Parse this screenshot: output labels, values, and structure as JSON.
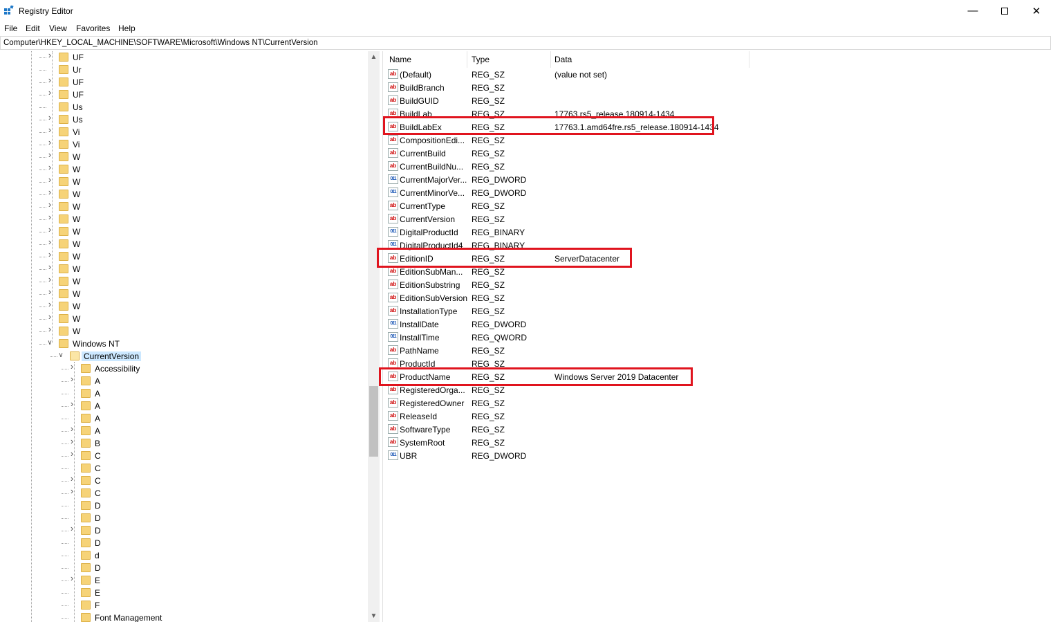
{
  "window": {
    "title": "Registry Editor"
  },
  "menu": [
    "File",
    "Edit",
    "View",
    "Favorites",
    "Help"
  ],
  "address": "Computer\\HKEY_LOCAL_MACHINE\\SOFTWARE\\Microsoft\\Windows NT\\CurrentVersion",
  "tree": {
    "siblings": [
      "UF",
      "Ur",
      "UF",
      "UF",
      "Us",
      "Us",
      "Vi",
      "Vi",
      "W",
      "W",
      "W",
      "W",
      "W",
      "W",
      "W",
      "W",
      "W",
      "W",
      "W",
      "W",
      "W",
      "W",
      "W"
    ],
    "parent": "Windows NT",
    "selected": "CurrentVersion",
    "children": [
      "Accessibility",
      "A",
      "A",
      "A",
      "A",
      "A",
      "B",
      "C",
      "C",
      "C",
      "C",
      "D",
      "D",
      "D",
      "D",
      "d",
      "D",
      "E",
      "E",
      "F",
      "Font Management"
    ]
  },
  "columns": {
    "name": "Name",
    "type": "Type",
    "data": "Data"
  },
  "values": [
    {
      "name": "(Default)",
      "type": "REG_SZ",
      "data": "(value not set)",
      "icon": "ab"
    },
    {
      "name": "BuildBranch",
      "type": "REG_SZ",
      "data": "",
      "icon": "ab"
    },
    {
      "name": "BuildGUID",
      "type": "REG_SZ",
      "data": "",
      "icon": "ab"
    },
    {
      "name": "BuildLab",
      "type": "REG_SZ",
      "data": "17763.rs5_release.180914-1434",
      "icon": "ab"
    },
    {
      "name": "BuildLabEx",
      "type": "REG_SZ",
      "data": "17763.1.amd64fre.rs5_release.180914-1434",
      "icon": "ab"
    },
    {
      "name": "CompositionEdi...",
      "type": "REG_SZ",
      "data": "",
      "icon": "ab"
    },
    {
      "name": "CurrentBuild",
      "type": "REG_SZ",
      "data": "",
      "icon": "ab"
    },
    {
      "name": "CurrentBuildNu...",
      "type": "REG_SZ",
      "data": "",
      "icon": "ab"
    },
    {
      "name": "CurrentMajorVer...",
      "type": "REG_DWORD",
      "data": "",
      "icon": "bin"
    },
    {
      "name": "CurrentMinorVe...",
      "type": "REG_DWORD",
      "data": "",
      "icon": "bin"
    },
    {
      "name": "CurrentType",
      "type": "REG_SZ",
      "data": "",
      "icon": "ab"
    },
    {
      "name": "CurrentVersion",
      "type": "REG_SZ",
      "data": "",
      "icon": "ab"
    },
    {
      "name": "DigitalProductId",
      "type": "REG_BINARY",
      "data": "",
      "icon": "bin"
    },
    {
      "name": "DigitalProductId4",
      "type": "REG_BINARY",
      "data": "",
      "icon": "bin"
    },
    {
      "name": "EditionID",
      "type": "REG_SZ",
      "data": "ServerDatacenter",
      "icon": "ab"
    },
    {
      "name": "EditionSubMan...",
      "type": "REG_SZ",
      "data": "",
      "icon": "ab"
    },
    {
      "name": "EditionSubstring",
      "type": "REG_SZ",
      "data": "",
      "icon": "ab"
    },
    {
      "name": "EditionSubVersion",
      "type": "REG_SZ",
      "data": "",
      "icon": "ab"
    },
    {
      "name": "InstallationType",
      "type": "REG_SZ",
      "data": "",
      "icon": "ab"
    },
    {
      "name": "InstallDate",
      "type": "REG_DWORD",
      "data": "",
      "icon": "bin"
    },
    {
      "name": "InstallTime",
      "type": "REG_QWORD",
      "data": "",
      "icon": "bin"
    },
    {
      "name": "PathName",
      "type": "REG_SZ",
      "data": "",
      "icon": "ab"
    },
    {
      "name": "ProductId",
      "type": "REG_SZ",
      "data": "",
      "icon": "ab"
    },
    {
      "name": "ProductName",
      "type": "REG_SZ",
      "data": "Windows Server 2019 Datacenter",
      "icon": "ab"
    },
    {
      "name": "RegisteredOrga...",
      "type": "REG_SZ",
      "data": "",
      "icon": "ab"
    },
    {
      "name": "RegisteredOwner",
      "type": "REG_SZ",
      "data": "",
      "icon": "ab"
    },
    {
      "name": "ReleaseId",
      "type": "REG_SZ",
      "data": "",
      "icon": "ab"
    },
    {
      "name": "SoftwareType",
      "type": "REG_SZ",
      "data": "",
      "icon": "ab"
    },
    {
      "name": "SystemRoot",
      "type": "REG_SZ",
      "data": "",
      "icon": "ab"
    },
    {
      "name": "UBR",
      "type": "REG_DWORD",
      "data": "",
      "icon": "bin"
    }
  ],
  "highlighted": [
    "BuildLabEx",
    "EditionID",
    "ProductName"
  ],
  "colors": {
    "highlight": "#e0141e",
    "selection": "#cce8ff",
    "folder": "#f6d378"
  }
}
